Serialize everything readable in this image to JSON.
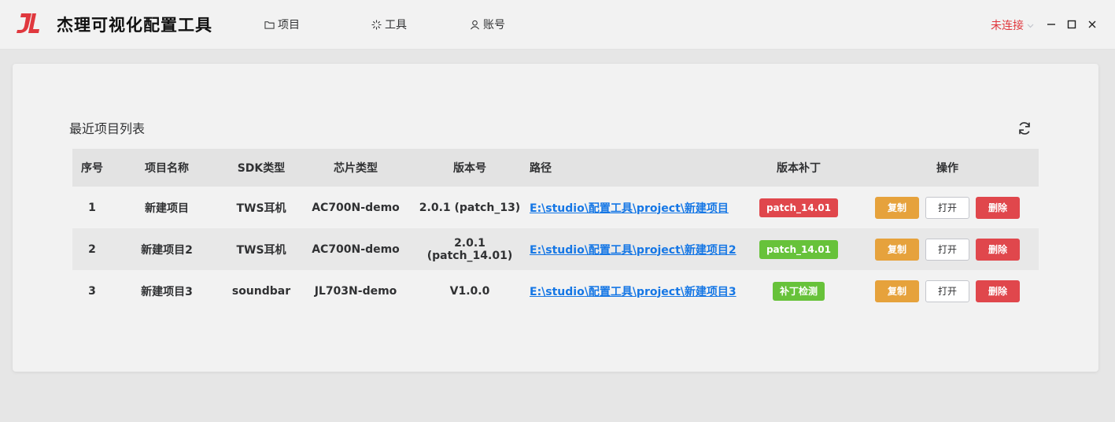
{
  "app": {
    "title": "杰理可视化配置工具",
    "logo_text": "JL"
  },
  "menu": [
    {
      "label": "项目",
      "icon": "folder-icon"
    },
    {
      "label": "工具",
      "icon": "loading-icon"
    },
    {
      "label": "账号",
      "icon": "user-icon"
    }
  ],
  "connection": {
    "status": "未连接"
  },
  "colors": {
    "accent": "#e0383e",
    "link": "#1677e5",
    "warning": "#e6a23c",
    "success": "#67c23a",
    "danger": "#e0474c"
  },
  "panel": {
    "title": "最近项目列表",
    "columns": [
      "序号",
      "项目名称",
      "SDK类型",
      "芯片类型",
      "版本号",
      "路径",
      "版本补丁",
      "操作"
    ],
    "rows": [
      {
        "index": "1",
        "name": "新建项目",
        "sdk": "TWS耳机",
        "chip": "AC700N-demo",
        "version": "2.0.1 (patch_13)",
        "path": "E:\\studio\\配置工具\\project\\新建项目",
        "patch": "patch_14.01",
        "patch_color": "red"
      },
      {
        "index": "2",
        "name": "新建项目2",
        "sdk": "TWS耳机",
        "chip": "AC700N-demo",
        "version": "2.0.1 (patch_14.01)",
        "path": "E:\\studio\\配置工具\\project\\新建项目2",
        "patch": "patch_14.01",
        "patch_color": "green"
      },
      {
        "index": "3",
        "name": "新建项目3",
        "sdk": "soundbar",
        "chip": "JL703N-demo",
        "version": "V1.0.0",
        "path": "E:\\studio\\配置工具\\project\\新建项目3",
        "patch": "补丁检测",
        "patch_color": "green"
      }
    ],
    "actions": {
      "copy": "复制",
      "open": "打开",
      "delete": "删除"
    }
  }
}
